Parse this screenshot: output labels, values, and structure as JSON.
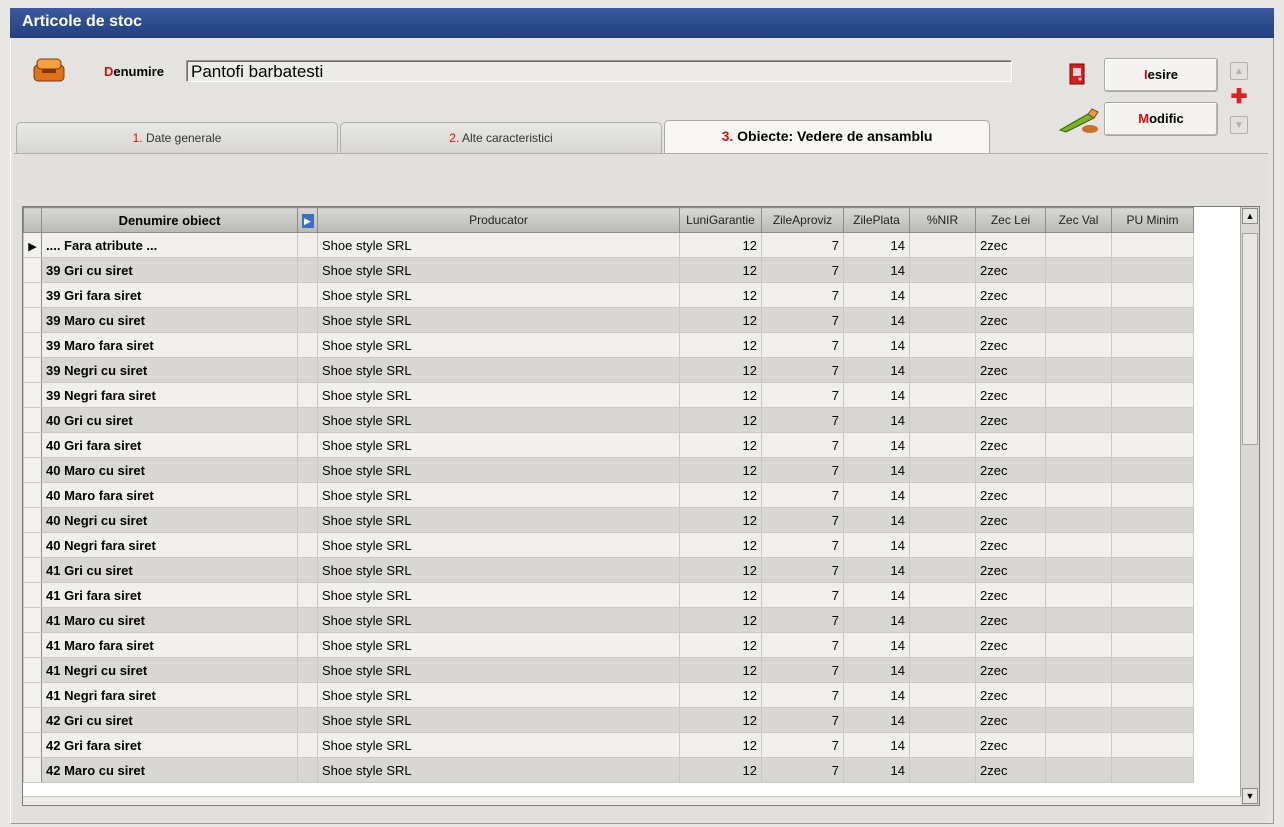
{
  "window": {
    "title": "Articole de stoc"
  },
  "header": {
    "denumire_label_initial": "D",
    "denumire_label_rest": "enumire",
    "denumire_value": "Pantofi barbatesti"
  },
  "buttons": {
    "iesire_initial": "I",
    "iesire_rest": "esire",
    "modific_initial": "M",
    "modific_rest": "odific"
  },
  "tabs": [
    {
      "num": "1.",
      "label": " Date generale"
    },
    {
      "num": "2.",
      "label": " Alte caracteristici"
    },
    {
      "num": "3.",
      "label": " Obiecte: Vedere de ansamblu"
    }
  ],
  "grid": {
    "columns": [
      "Denumire obiect",
      "Producator",
      "LuniGarantie",
      "ZileAproviz",
      "ZilePlata",
      "%NIR",
      "Zec Lei",
      "Zec Val",
      "PU Minim"
    ],
    "rows": [
      {
        "name": ".... Fara atribute ...",
        "producator": "Shoe style SRL",
        "luni": "12",
        "zile_aprov": "7",
        "zile_plata": "14",
        "nir": "",
        "zec_lei": "2zec",
        "zec_val": "",
        "pu_minim": ""
      },
      {
        "name": "39 Gri cu siret",
        "producator": "Shoe style SRL",
        "luni": "12",
        "zile_aprov": "7",
        "zile_plata": "14",
        "nir": "",
        "zec_lei": "2zec",
        "zec_val": "",
        "pu_minim": ""
      },
      {
        "name": "39 Gri fara siret",
        "producator": "Shoe style SRL",
        "luni": "12",
        "zile_aprov": "7",
        "zile_plata": "14",
        "nir": "",
        "zec_lei": "2zec",
        "zec_val": "",
        "pu_minim": ""
      },
      {
        "name": "39 Maro cu siret",
        "producator": "Shoe style SRL",
        "luni": "12",
        "zile_aprov": "7",
        "zile_plata": "14",
        "nir": "",
        "zec_lei": "2zec",
        "zec_val": "",
        "pu_minim": ""
      },
      {
        "name": "39 Maro fara siret",
        "producator": "Shoe style SRL",
        "luni": "12",
        "zile_aprov": "7",
        "zile_plata": "14",
        "nir": "",
        "zec_lei": "2zec",
        "zec_val": "",
        "pu_minim": ""
      },
      {
        "name": "39 Negri cu siret",
        "producator": "Shoe style SRL",
        "luni": "12",
        "zile_aprov": "7",
        "zile_plata": "14",
        "nir": "",
        "zec_lei": "2zec",
        "zec_val": "",
        "pu_minim": ""
      },
      {
        "name": "39 Negri fara siret",
        "producator": "Shoe style SRL",
        "luni": "12",
        "zile_aprov": "7",
        "zile_plata": "14",
        "nir": "",
        "zec_lei": "2zec",
        "zec_val": "",
        "pu_minim": ""
      },
      {
        "name": "40 Gri cu siret",
        "producator": "Shoe style SRL",
        "luni": "12",
        "zile_aprov": "7",
        "zile_plata": "14",
        "nir": "",
        "zec_lei": "2zec",
        "zec_val": "",
        "pu_minim": ""
      },
      {
        "name": "40 Gri fara siret",
        "producator": "Shoe style SRL",
        "luni": "12",
        "zile_aprov": "7",
        "zile_plata": "14",
        "nir": "",
        "zec_lei": "2zec",
        "zec_val": "",
        "pu_minim": ""
      },
      {
        "name": "40 Maro cu siret",
        "producator": "Shoe style SRL",
        "luni": "12",
        "zile_aprov": "7",
        "zile_plata": "14",
        "nir": "",
        "zec_lei": "2zec",
        "zec_val": "",
        "pu_minim": ""
      },
      {
        "name": "40 Maro fara siret",
        "producator": "Shoe style SRL",
        "luni": "12",
        "zile_aprov": "7",
        "zile_plata": "14",
        "nir": "",
        "zec_lei": "2zec",
        "zec_val": "",
        "pu_minim": ""
      },
      {
        "name": "40 Negri cu siret",
        "producator": "Shoe style SRL",
        "luni": "12",
        "zile_aprov": "7",
        "zile_plata": "14",
        "nir": "",
        "zec_lei": "2zec",
        "zec_val": "",
        "pu_minim": ""
      },
      {
        "name": "40 Negri fara siret",
        "producator": "Shoe style SRL",
        "luni": "12",
        "zile_aprov": "7",
        "zile_plata": "14",
        "nir": "",
        "zec_lei": "2zec",
        "zec_val": "",
        "pu_minim": ""
      },
      {
        "name": "41 Gri cu siret",
        "producator": "Shoe style SRL",
        "luni": "12",
        "zile_aprov": "7",
        "zile_plata": "14",
        "nir": "",
        "zec_lei": "2zec",
        "zec_val": "",
        "pu_minim": ""
      },
      {
        "name": "41 Gri fara siret",
        "producator": "Shoe style SRL",
        "luni": "12",
        "zile_aprov": "7",
        "zile_plata": "14",
        "nir": "",
        "zec_lei": "2zec",
        "zec_val": "",
        "pu_minim": ""
      },
      {
        "name": "41 Maro cu siret",
        "producator": "Shoe style SRL",
        "luni": "12",
        "zile_aprov": "7",
        "zile_plata": "14",
        "nir": "",
        "zec_lei": "2zec",
        "zec_val": "",
        "pu_minim": ""
      },
      {
        "name": "41 Maro fara siret",
        "producator": "Shoe style SRL",
        "luni": "12",
        "zile_aprov": "7",
        "zile_plata": "14",
        "nir": "",
        "zec_lei": "2zec",
        "zec_val": "",
        "pu_minim": ""
      },
      {
        "name": "41 Negri cu siret",
        "producator": "Shoe style SRL",
        "luni": "12",
        "zile_aprov": "7",
        "zile_plata": "14",
        "nir": "",
        "zec_lei": "2zec",
        "zec_val": "",
        "pu_minim": ""
      },
      {
        "name": "41 Negri fara siret",
        "producator": "Shoe style SRL",
        "luni": "12",
        "zile_aprov": "7",
        "zile_plata": "14",
        "nir": "",
        "zec_lei": "2zec",
        "zec_val": "",
        "pu_minim": ""
      },
      {
        "name": "42 Gri cu siret",
        "producator": "Shoe style SRL",
        "luni": "12",
        "zile_aprov": "7",
        "zile_plata": "14",
        "nir": "",
        "zec_lei": "2zec",
        "zec_val": "",
        "pu_minim": ""
      },
      {
        "name": "42 Gri fara siret",
        "producator": "Shoe style SRL",
        "luni": "12",
        "zile_aprov": "7",
        "zile_plata": "14",
        "nir": "",
        "zec_lei": "2zec",
        "zec_val": "",
        "pu_minim": ""
      },
      {
        "name": "42 Maro cu siret",
        "producator": "Shoe style SRL",
        "luni": "12",
        "zile_aprov": "7",
        "zile_plata": "14",
        "nir": "",
        "zec_lei": "2zec",
        "zec_val": "",
        "pu_minim": ""
      }
    ]
  },
  "icons": {
    "app": "box-icon",
    "exit": "exit-door-icon",
    "edit": "pencil-icon",
    "up": "arrow-up-icon",
    "add": "plus-icon",
    "down": "arrow-down-icon",
    "current_row": "row-pointer-icon"
  },
  "colors": {
    "accent": "#d01010",
    "title_bar": "#2b4a8a"
  }
}
